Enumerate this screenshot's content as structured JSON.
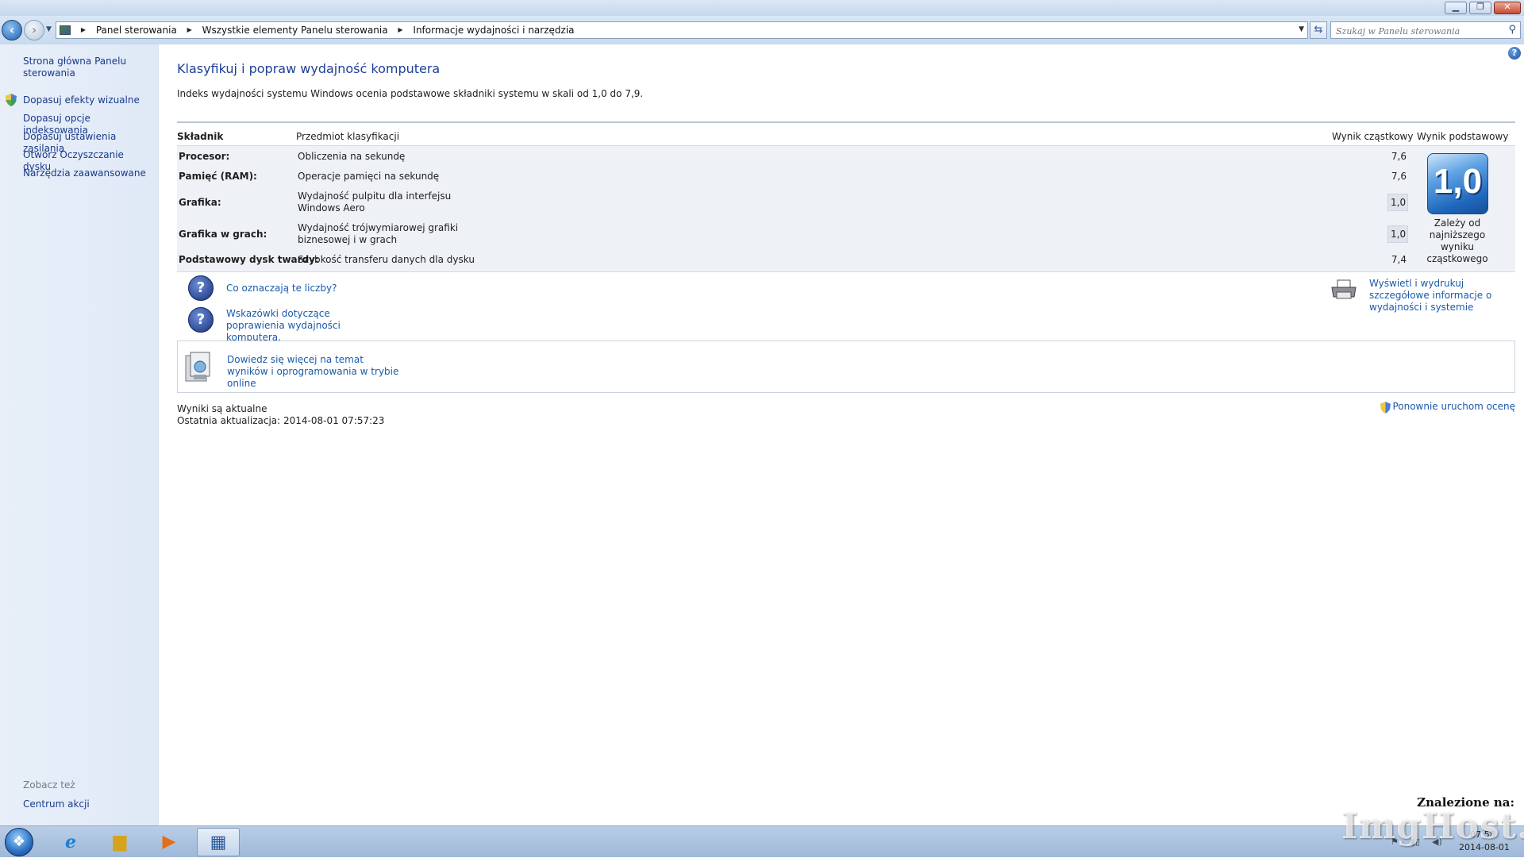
{
  "window": {
    "minimize_glyph": "▁",
    "maximize_glyph": "❐",
    "close_glyph": "✕"
  },
  "address": {
    "breadcrumbs": [
      "Panel sterowania",
      "Wszystkie elementy Panelu sterowania",
      "Informacje wydajności i narzędzia"
    ],
    "search_placeholder": "Szukaj w Panelu sterowania"
  },
  "left_pane": {
    "home_link": "Strona główna Panelu sterowania",
    "tasks": [
      "Dopasuj efekty wizualne",
      "Dopasuj opcje indeksowania",
      "Dopasuj ustawienia zasilania",
      "Otwórz Oczyszczanie dysku",
      "Narzędzia zaawansowane"
    ],
    "see_also_title": "Zobacz też",
    "see_also_items": [
      "Centrum akcji"
    ]
  },
  "main": {
    "title": "Klasyfikuj i popraw wydajność komputera",
    "description": "Indeks wydajności systemu Windows ocenia podstawowe składniki systemu w skali od 1,0 do 7,9.",
    "table": {
      "headers": {
        "component": "Składnik",
        "subject": "Przedmiot klasyfikacji",
        "subscore": "Wynik cząstkowy",
        "base": "Wynik podstawowy"
      },
      "rows": [
        {
          "component": "Procesor:",
          "subject": "Obliczenia na sekundę",
          "score": "7,6"
        },
        {
          "component": "Pamięć (RAM):",
          "subject": "Operacje pamięci na sekundę",
          "score": "7,6"
        },
        {
          "component": "Grafika:",
          "subject": "Wydajność pulpitu dla interfejsu Windows Aero",
          "score": "1,0"
        },
        {
          "component": "Grafika w grach:",
          "subject": "Wydajność trójwymiarowej grafiki biznesowej i w grach",
          "score": "1,0"
        },
        {
          "component": "Podstawowy dysk twardy:",
          "subject": "Szybkość transferu danych dla dysku",
          "score": "7,4"
        }
      ],
      "base_score": "1,0",
      "base_note": "Zależy od najniższego wyniku cząstkowego"
    },
    "help_links": [
      "Co oznaczają te liczby?",
      "Wskazówki dotyczące poprawienia wydajności komputera."
    ],
    "print_link": "Wyświetl i wydrukuj szczegółowe informacje o wydajności i systemie",
    "online_link": "Dowiedz się więcej na temat wyników i oprogramowania w trybie online",
    "status": "Wyniki są aktualne",
    "last_update": "Ostatnia aktualizacja: 2014-08-01 07:57:23",
    "rerun_link": "Ponownie uruchom ocenę",
    "found_label": "Znalezione na:"
  },
  "taskbar": {
    "clock_time": "07:58",
    "clock_date": "2014-08-01",
    "tray_icons": [
      "flag-icon",
      "network-icon",
      "volume-icon"
    ]
  },
  "watermark": "ImgHost.pl"
}
